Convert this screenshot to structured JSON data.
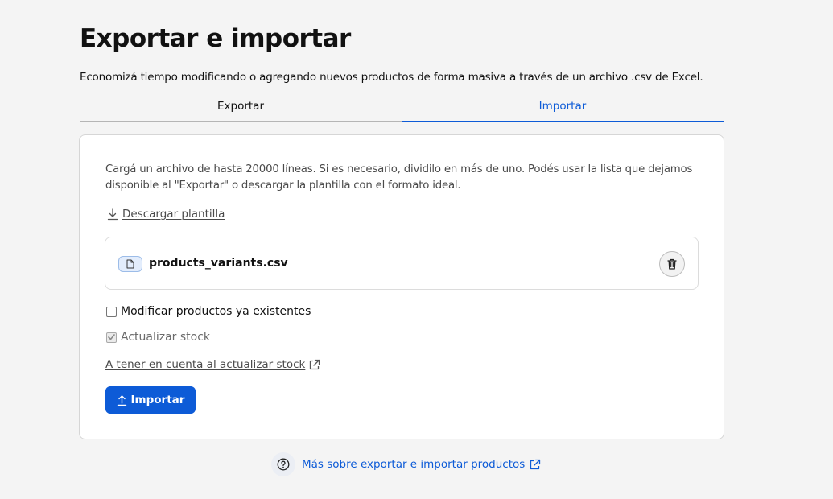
{
  "page": {
    "title": "Exportar e importar",
    "subtitle": "Economizá tiempo modificando o agregando nuevos productos de forma masiva a través de un archivo .csv de Excel."
  },
  "tabs": [
    {
      "label": "Exportar",
      "active": false
    },
    {
      "label": "Importar",
      "active": true
    }
  ],
  "import_card": {
    "description": "Cargá un archivo de hasta 20000 líneas. Si es necesario, dividilo en más de uno. Podés usar la lista que dejamos disponible al \"Exportar\" o descargar la plantilla con el formato ideal.",
    "download_template_label": "Descargar plantilla",
    "file": {
      "name": "products_variants.csv"
    },
    "options": [
      {
        "label": "Modificar productos ya existentes",
        "checked": false,
        "disabled": false
      },
      {
        "label": "Actualizar stock",
        "checked": true,
        "disabled": true
      }
    ],
    "stock_note_link": "A tener en cuenta al actualizar stock",
    "import_button": "Importar"
  },
  "help": {
    "link_label": "Más sobre exportar e importar productos"
  },
  "colors": {
    "accent": "#0d5bd7",
    "background": "#f4f4f4",
    "card": "#ffffff"
  },
  "icons": {
    "download": "download-icon",
    "file": "file-icon",
    "trash": "trash-icon",
    "external": "external-link-icon",
    "upload": "upload-icon",
    "help": "help-circle-icon"
  }
}
